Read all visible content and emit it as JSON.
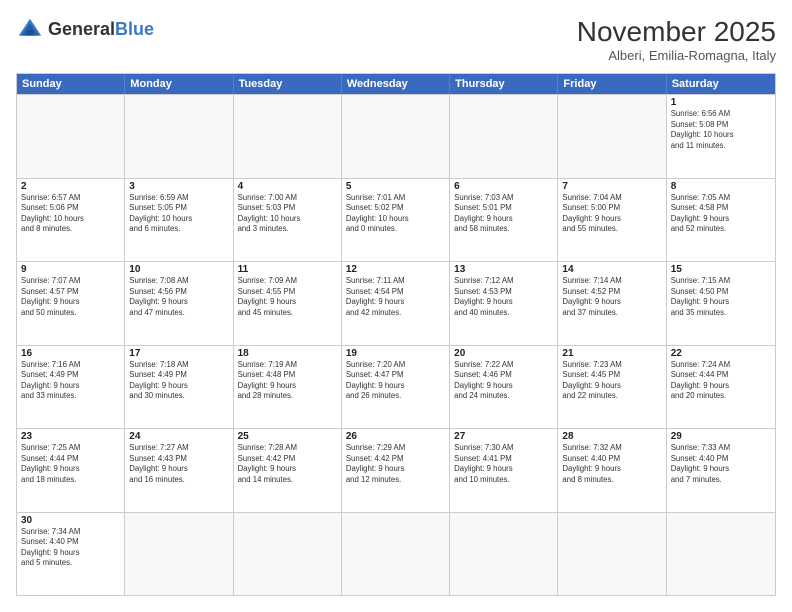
{
  "header": {
    "logo_general": "General",
    "logo_blue": "Blue",
    "month_title": "November 2025",
    "location": "Alberi, Emilia-Romagna, Italy"
  },
  "day_headers": [
    "Sunday",
    "Monday",
    "Tuesday",
    "Wednesday",
    "Thursday",
    "Friday",
    "Saturday"
  ],
  "weeks": [
    [
      {
        "day": "",
        "info": ""
      },
      {
        "day": "",
        "info": ""
      },
      {
        "day": "",
        "info": ""
      },
      {
        "day": "",
        "info": ""
      },
      {
        "day": "",
        "info": ""
      },
      {
        "day": "",
        "info": ""
      },
      {
        "day": "1",
        "info": "Sunrise: 6:56 AM\nSunset: 5:08 PM\nDaylight: 10 hours\nand 11 minutes."
      }
    ],
    [
      {
        "day": "2",
        "info": "Sunrise: 6:57 AM\nSunset: 5:06 PM\nDaylight: 10 hours\nand 8 minutes."
      },
      {
        "day": "3",
        "info": "Sunrise: 6:59 AM\nSunset: 5:05 PM\nDaylight: 10 hours\nand 6 minutes."
      },
      {
        "day": "4",
        "info": "Sunrise: 7:00 AM\nSunset: 5:03 PM\nDaylight: 10 hours\nand 3 minutes."
      },
      {
        "day": "5",
        "info": "Sunrise: 7:01 AM\nSunset: 5:02 PM\nDaylight: 10 hours\nand 0 minutes."
      },
      {
        "day": "6",
        "info": "Sunrise: 7:03 AM\nSunset: 5:01 PM\nDaylight: 9 hours\nand 58 minutes."
      },
      {
        "day": "7",
        "info": "Sunrise: 7:04 AM\nSunset: 5:00 PM\nDaylight: 9 hours\nand 55 minutes."
      },
      {
        "day": "8",
        "info": "Sunrise: 7:05 AM\nSunset: 4:58 PM\nDaylight: 9 hours\nand 52 minutes."
      }
    ],
    [
      {
        "day": "9",
        "info": "Sunrise: 7:07 AM\nSunset: 4:57 PM\nDaylight: 9 hours\nand 50 minutes."
      },
      {
        "day": "10",
        "info": "Sunrise: 7:08 AM\nSunset: 4:56 PM\nDaylight: 9 hours\nand 47 minutes."
      },
      {
        "day": "11",
        "info": "Sunrise: 7:09 AM\nSunset: 4:55 PM\nDaylight: 9 hours\nand 45 minutes."
      },
      {
        "day": "12",
        "info": "Sunrise: 7:11 AM\nSunset: 4:54 PM\nDaylight: 9 hours\nand 42 minutes."
      },
      {
        "day": "13",
        "info": "Sunrise: 7:12 AM\nSunset: 4:53 PM\nDaylight: 9 hours\nand 40 minutes."
      },
      {
        "day": "14",
        "info": "Sunrise: 7:14 AM\nSunset: 4:52 PM\nDaylight: 9 hours\nand 37 minutes."
      },
      {
        "day": "15",
        "info": "Sunrise: 7:15 AM\nSunset: 4:50 PM\nDaylight: 9 hours\nand 35 minutes."
      }
    ],
    [
      {
        "day": "16",
        "info": "Sunrise: 7:16 AM\nSunset: 4:49 PM\nDaylight: 9 hours\nand 33 minutes."
      },
      {
        "day": "17",
        "info": "Sunrise: 7:18 AM\nSunset: 4:49 PM\nDaylight: 9 hours\nand 30 minutes."
      },
      {
        "day": "18",
        "info": "Sunrise: 7:19 AM\nSunset: 4:48 PM\nDaylight: 9 hours\nand 28 minutes."
      },
      {
        "day": "19",
        "info": "Sunrise: 7:20 AM\nSunset: 4:47 PM\nDaylight: 9 hours\nand 26 minutes."
      },
      {
        "day": "20",
        "info": "Sunrise: 7:22 AM\nSunset: 4:46 PM\nDaylight: 9 hours\nand 24 minutes."
      },
      {
        "day": "21",
        "info": "Sunrise: 7:23 AM\nSunset: 4:45 PM\nDaylight: 9 hours\nand 22 minutes."
      },
      {
        "day": "22",
        "info": "Sunrise: 7:24 AM\nSunset: 4:44 PM\nDaylight: 9 hours\nand 20 minutes."
      }
    ],
    [
      {
        "day": "23",
        "info": "Sunrise: 7:25 AM\nSunset: 4:44 PM\nDaylight: 9 hours\nand 18 minutes."
      },
      {
        "day": "24",
        "info": "Sunrise: 7:27 AM\nSunset: 4:43 PM\nDaylight: 9 hours\nand 16 minutes."
      },
      {
        "day": "25",
        "info": "Sunrise: 7:28 AM\nSunset: 4:42 PM\nDaylight: 9 hours\nand 14 minutes."
      },
      {
        "day": "26",
        "info": "Sunrise: 7:29 AM\nSunset: 4:42 PM\nDaylight: 9 hours\nand 12 minutes."
      },
      {
        "day": "27",
        "info": "Sunrise: 7:30 AM\nSunset: 4:41 PM\nDaylight: 9 hours\nand 10 minutes."
      },
      {
        "day": "28",
        "info": "Sunrise: 7:32 AM\nSunset: 4:40 PM\nDaylight: 9 hours\nand 8 minutes."
      },
      {
        "day": "29",
        "info": "Sunrise: 7:33 AM\nSunset: 4:40 PM\nDaylight: 9 hours\nand 7 minutes."
      }
    ],
    [
      {
        "day": "30",
        "info": "Sunrise: 7:34 AM\nSunset: 4:40 PM\nDaylight: 9 hours\nand 5 minutes."
      },
      {
        "day": "",
        "info": ""
      },
      {
        "day": "",
        "info": ""
      },
      {
        "day": "",
        "info": ""
      },
      {
        "day": "",
        "info": ""
      },
      {
        "day": "",
        "info": ""
      },
      {
        "day": "",
        "info": ""
      }
    ]
  ]
}
